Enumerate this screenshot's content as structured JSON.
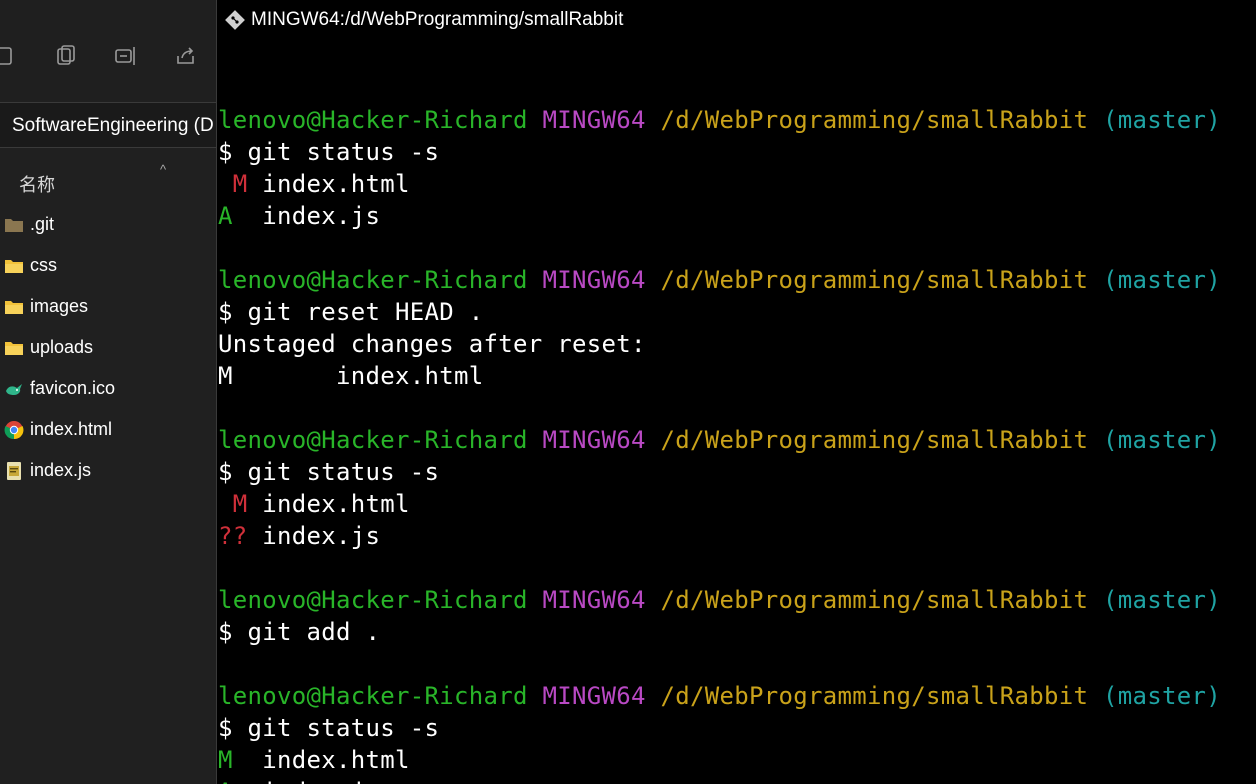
{
  "explorer": {
    "breadcrumb": "SoftwareEngineering (D",
    "column_name": "名称",
    "sort_indicator": "^",
    "toolbar_icons": [
      "cut-icon",
      "paste-icon",
      "rename-icon",
      "share-icon"
    ],
    "files": [
      {
        "name": ".git",
        "icon": "folder-icon-dim"
      },
      {
        "name": "css",
        "icon": "folder-icon"
      },
      {
        "name": "images",
        "icon": "folder-icon"
      },
      {
        "name": "uploads",
        "icon": "folder-icon"
      },
      {
        "name": "favicon.ico",
        "icon": "rabbit-icon"
      },
      {
        "name": "index.html",
        "icon": "chrome-icon"
      },
      {
        "name": "index.js",
        "icon": "js-file-icon"
      }
    ]
  },
  "terminal": {
    "title": "MINGW64:/d/WebProgramming/smallRabbit",
    "prompt": {
      "user": "lenovo@Hacker-Richard",
      "system": "MINGW64",
      "path": "/d/WebProgramming/smallRabbit",
      "branch": "(master)"
    },
    "lines": [
      {
        "kind": "blank"
      },
      {
        "kind": "prompt"
      },
      {
        "kind": "cmd",
        "text": "$ git status -s"
      },
      {
        "kind": "status",
        "code": " M",
        "code_color": "red",
        "file": " index.html"
      },
      {
        "kind": "status",
        "code": "A ",
        "code_color": "green",
        "file": " index.js"
      },
      {
        "kind": "blank"
      },
      {
        "kind": "prompt"
      },
      {
        "kind": "cmd",
        "text": "$ git reset HEAD ."
      },
      {
        "kind": "out",
        "text": "Unstaged changes after reset:"
      },
      {
        "kind": "out",
        "text": "M       index.html"
      },
      {
        "kind": "blank"
      },
      {
        "kind": "prompt"
      },
      {
        "kind": "cmd",
        "text": "$ git status -s"
      },
      {
        "kind": "status",
        "code": " M",
        "code_color": "red",
        "file": " index.html"
      },
      {
        "kind": "status",
        "code": "??",
        "code_color": "red",
        "file": " index.js"
      },
      {
        "kind": "blank"
      },
      {
        "kind": "prompt"
      },
      {
        "kind": "cmd",
        "text": "$ git add ."
      },
      {
        "kind": "blank"
      },
      {
        "kind": "prompt"
      },
      {
        "kind": "cmd",
        "text": "$ git status -s"
      },
      {
        "kind": "status",
        "code": "M ",
        "code_color": "green",
        "file": " index.html"
      },
      {
        "kind": "status",
        "code": "A ",
        "code_color": "green",
        "file": " index.js"
      }
    ]
  },
  "colors": {
    "user": "#29b529",
    "system": "#b949c4",
    "path": "#c9a21a",
    "branch": "#1fa3a3",
    "red": "#d0303a",
    "green": "#29b529"
  }
}
